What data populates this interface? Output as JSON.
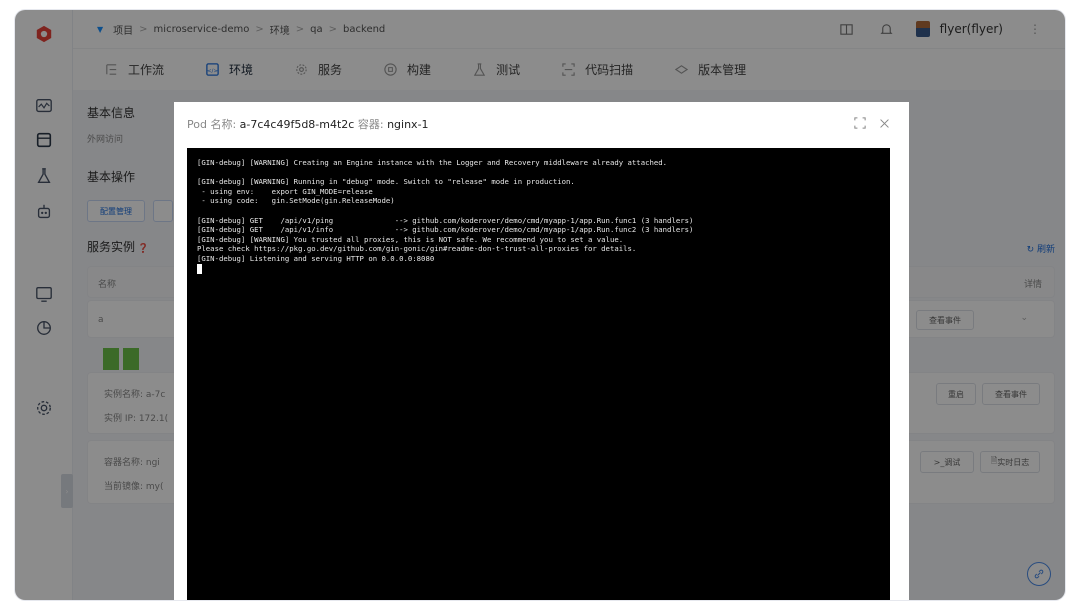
{
  "breadcrumb": [
    "项目",
    "microservice-demo",
    "环境",
    "qa",
    "backend"
  ],
  "breadcrumb_separator": ">",
  "user": {
    "name": "flyer(flyer)"
  },
  "nav_tabs": [
    {
      "label": "工作流",
      "icon": "workflow-icon"
    },
    {
      "label": "环境",
      "icon": "environment-icon",
      "active": true
    },
    {
      "label": "服务",
      "icon": "service-icon"
    },
    {
      "label": "构建",
      "icon": "build-icon"
    },
    {
      "label": "测试",
      "icon": "test-icon"
    },
    {
      "label": "代码扫描",
      "icon": "code-scan-icon"
    },
    {
      "label": "版本管理",
      "icon": "version-icon"
    }
  ],
  "background": {
    "basic_info": "基本信息",
    "external_access": "外网访问",
    "basic_ops": "基本操作",
    "config_manage": "配置管理",
    "service_instances": "服务实例",
    "refresh": "刷新",
    "col_name": "名称",
    "col_detail": "详情",
    "row_name": "a",
    "view_events": "查看事件",
    "instance_name_label": "实例名称: a-7c",
    "instance_ip_label": "实例 IP: 172.1(",
    "restart": "重启",
    "container_name_label": "容器名称: ngi",
    "current_image_label": "当前镜像: my(",
    "debug": "调试",
    "realtime_log": "实时日志"
  },
  "dialog": {
    "pod_label": "Pod 名称:",
    "pod_name": "a-7c4c49f5d8-m4t2c",
    "container_label": "容器:",
    "container_name": "nginx-1",
    "terminal_lines": [
      "[GIN-debug] [WARNING] Creating an Engine instance with the Logger and Recovery middleware already attached.",
      "",
      "[GIN-debug] [WARNING] Running in \"debug\" mode. Switch to \"release\" mode in production.",
      " - using env:    export GIN_MODE=release",
      " - using code:   gin.SetMode(gin.ReleaseMode)",
      "",
      "[GIN-debug] GET    /api/v1/ping              --> github.com/koderover/demo/cmd/myapp-1/app.Run.func1 (3 handlers)",
      "[GIN-debug] GET    /api/v1/info              --> github.com/koderover/demo/cmd/myapp-1/app.Run.func2 (3 handlers)",
      "[GIN-debug] [WARNING] You trusted all proxies, this is NOT safe. We recommend you to set a value.",
      "Please check https://pkg.go.dev/github.com/gin-gonic/gin#readme-don-t-trust-all-proxies for details.",
      "[GIN-debug] Listening and serving HTTP on 0.0.0.0:8080"
    ]
  },
  "colors": {
    "accent": "#1f6fdd",
    "terminal_bg": "#000000",
    "status_green": "#6cc24a"
  }
}
